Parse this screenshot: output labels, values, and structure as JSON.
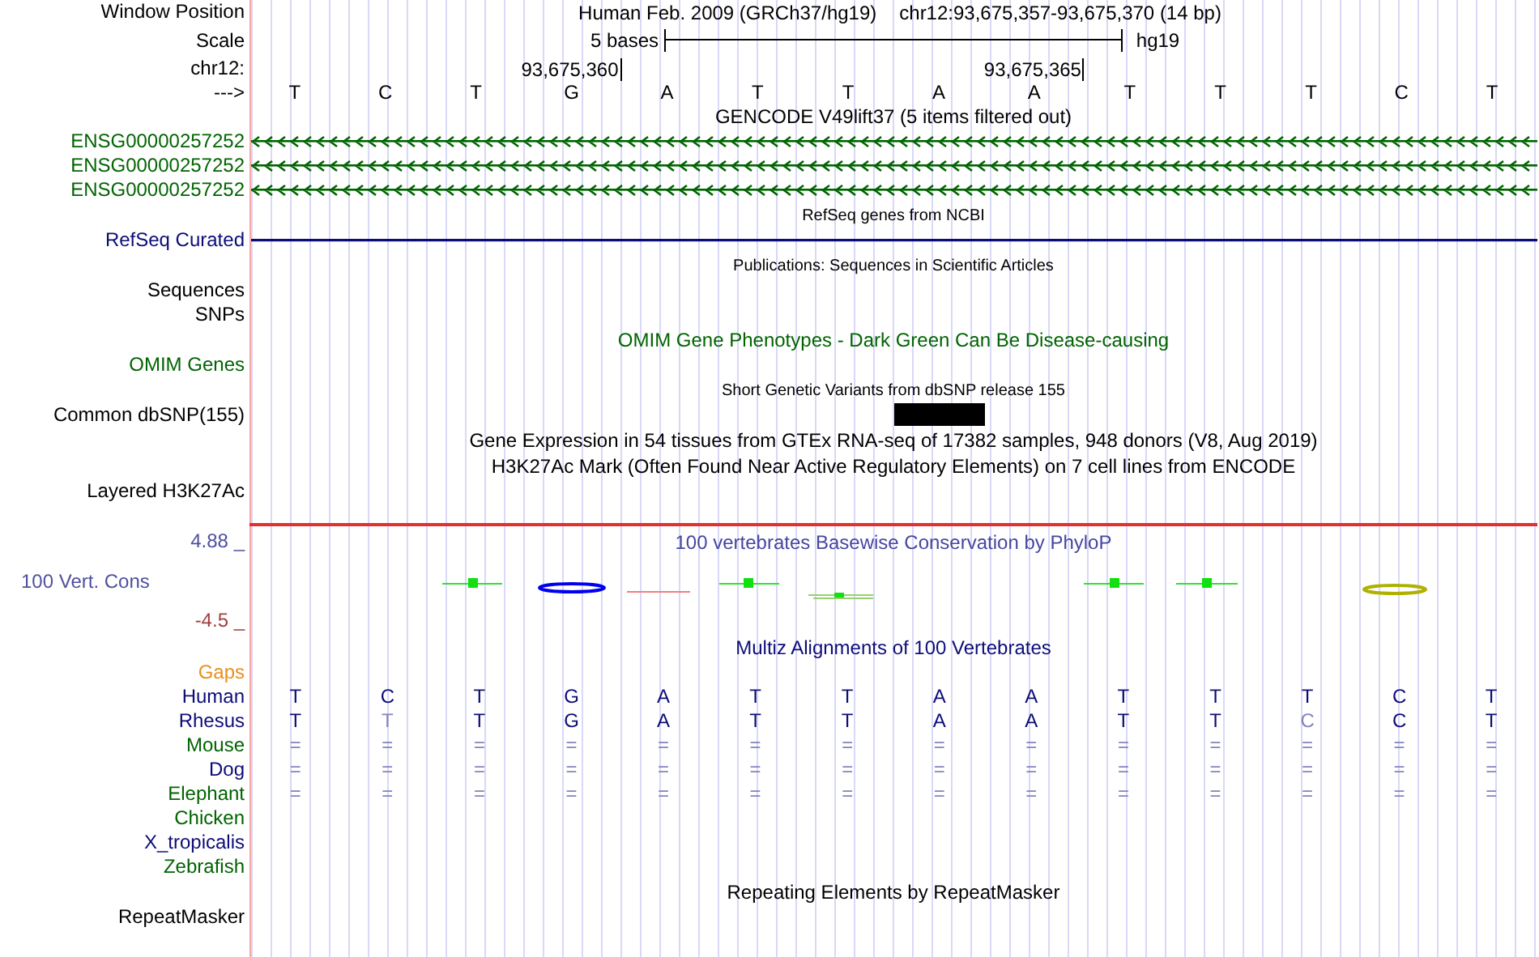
{
  "rows": [
    {
      "kind": "title",
      "label": "Window Position",
      "assembly": "Human Feb. 2009 (GRCh37/hg19)",
      "position": "chr12:93,675,357-93,675,370 (14 bp)"
    },
    {
      "kind": "scale",
      "label": "Scale",
      "span": "5 bases",
      "assembly": "hg19"
    },
    {
      "kind": "sequence",
      "coordinate_label": "chr12:",
      "label": "--->",
      "bases": [
        {
          "base": "T",
          "variant": false
        },
        {
          "base": "C",
          "variant": false
        },
        {
          "base": "T",
          "variant": false
        },
        {
          "base": "G",
          "coordinate": "93,675,360",
          "variant": false
        },
        {
          "base": "A",
          "variant": false
        },
        {
          "base": "T",
          "variant": false
        },
        {
          "base": "T",
          "variant": false
        },
        {
          "base": "A",
          "variant": true
        },
        {
          "base": "A",
          "coordinate": "93,675,365",
          "variant": false
        },
        {
          "base": "T",
          "variant": false
        },
        {
          "base": "T",
          "variant": false
        },
        {
          "base": "T",
          "variant": false
        },
        {
          "base": "C",
          "variant": false
        },
        {
          "base": "T",
          "variant": false
        }
      ]
    },
    {
      "kind": "header",
      "text": "GENCODE V49lift37 (5 items filtered out)"
    },
    {
      "kind": "gene",
      "label": "ENSG00000257252",
      "color": "#006400",
      "arrows": true
    },
    {
      "kind": "gene",
      "label": "ENSG00000257252",
      "color": "#006400",
      "arrows": true
    },
    {
      "kind": "gene",
      "label": "ENSG00000257252",
      "color": "#006400",
      "arrows": true
    },
    {
      "kind": "caption",
      "text": "RefSeq genes from NCBI"
    },
    {
      "kind": "gene",
      "label": "RefSeq Curated",
      "color": "#0c0c78",
      "arrows": false
    },
    {
      "kind": "caption",
      "text": "Publications: Sequences in Scientific Articles"
    },
    {
      "kind": "label",
      "label": "Sequences"
    },
    {
      "kind": "label",
      "label": "SNPs"
    },
    {
      "kind": "header",
      "text": "OMIM Gene Phenotypes - Dark Green Can Be Disease-causing",
      "color": "#006400"
    },
    {
      "kind": "label",
      "label": "OMIM Genes",
      "color": "#006400"
    },
    {
      "kind": "caption",
      "text": "Short Genetic Variants from dbSNP release 155"
    },
    {
      "kind": "variants",
      "label": "Common dbSNP(155)"
    },
    {
      "kind": "header",
      "text": "Gene Expression in 54 tissues from GTEx RNA-seq of 17382 samples, 948 donors (V8, Aug 2019)"
    },
    {
      "kind": "header",
      "text": "H3K27Ac Mark (Often Found Near Active Regulatory Elements) on 7 cell lines from ENCODE"
    },
    {
      "kind": "signal",
      "label": "Layered H3K27Ac"
    },
    {
      "kind": "conservation",
      "max": "4.88 _",
      "title": "100 vertebrates Basewise Conservation by PhyloP",
      "label": "100 Vert. Cons",
      "min": "-4.5 _"
    },
    {
      "kind": "header",
      "text": "Multiz Alignments of 100 Vertebrates",
      "color": "#0c0c78"
    },
    {
      "kind": "label",
      "label": "Gaps",
      "color": "#e8901c"
    },
    {
      "kind": "alignment",
      "label": "Human",
      "color": "#0c0c78",
      "bases": [
        {
          "text": "T",
          "faded": false
        },
        {
          "text": "C",
          "faded": false
        },
        {
          "text": "T",
          "faded": false
        },
        {
          "text": "G",
          "faded": false
        },
        {
          "text": "A",
          "faded": false
        },
        {
          "text": "T",
          "faded": false
        },
        {
          "text": "T",
          "faded": false
        },
        {
          "text": "A",
          "faded": false
        },
        {
          "text": "A",
          "faded": false
        },
        {
          "text": "T",
          "faded": false
        },
        {
          "text": "T",
          "faded": false
        },
        {
          "text": "T",
          "faded": false
        },
        {
          "text": "C",
          "faded": false
        },
        {
          "text": "T",
          "faded": false
        }
      ]
    },
    {
      "kind": "alignment",
      "label": "Rhesus",
      "color": "#0c0c78",
      "bases": [
        {
          "text": "T",
          "faded": false
        },
        {
          "text": "T",
          "faded": true
        },
        {
          "text": "T",
          "faded": false
        },
        {
          "text": "G",
          "faded": false
        },
        {
          "text": "A",
          "faded": false
        },
        {
          "text": "T",
          "faded": false
        },
        {
          "text": "T",
          "faded": false
        },
        {
          "text": "A",
          "faded": false
        },
        {
          "text": "A",
          "faded": false
        },
        {
          "text": "T",
          "faded": false
        },
        {
          "text": "T",
          "faded": false
        },
        {
          "text": "C",
          "faded": true
        },
        {
          "text": "C",
          "faded": false
        },
        {
          "text": "T",
          "faded": false
        }
      ]
    },
    {
      "kind": "alignment",
      "label": "Mouse",
      "color": "#006400",
      "bases": [
        {
          "text": "=",
          "faded": true
        },
        {
          "text": "=",
          "faded": true
        },
        {
          "text": "=",
          "faded": true
        },
        {
          "text": "=",
          "faded": true
        },
        {
          "text": "=",
          "faded": true
        },
        {
          "text": "=",
          "faded": true
        },
        {
          "text": "=",
          "faded": true
        },
        {
          "text": "=",
          "faded": true
        },
        {
          "text": "=",
          "faded": true
        },
        {
          "text": "=",
          "faded": true
        },
        {
          "text": "=",
          "faded": true
        },
        {
          "text": "=",
          "faded": true
        },
        {
          "text": "=",
          "faded": true
        },
        {
          "text": "=",
          "faded": true
        }
      ]
    },
    {
      "kind": "alignment",
      "label": "Dog",
      "color": "#0c0c78",
      "bases": [
        {
          "text": "=",
          "faded": true
        },
        {
          "text": "=",
          "faded": true
        },
        {
          "text": "=",
          "faded": true
        },
        {
          "text": "=",
          "faded": true
        },
        {
          "text": "=",
          "faded": true
        },
        {
          "text": "=",
          "faded": true
        },
        {
          "text": "=",
          "faded": true
        },
        {
          "text": "=",
          "faded": true
        },
        {
          "text": "=",
          "faded": true
        },
        {
          "text": "=",
          "faded": true
        },
        {
          "text": "=",
          "faded": true
        },
        {
          "text": "=",
          "faded": true
        },
        {
          "text": "=",
          "faded": true
        },
        {
          "text": "=",
          "faded": true
        }
      ]
    },
    {
      "kind": "alignment",
      "label": "Elephant",
      "color": "#006400",
      "bases": [
        {
          "text": "=",
          "faded": true
        },
        {
          "text": "=",
          "faded": true
        },
        {
          "text": "=",
          "faded": true
        },
        {
          "text": "=",
          "faded": true
        },
        {
          "text": "=",
          "faded": true
        },
        {
          "text": "=",
          "faded": true
        },
        {
          "text": "=",
          "faded": true
        },
        {
          "text": "=",
          "faded": true
        },
        {
          "text": "=",
          "faded": true
        },
        {
          "text": "=",
          "faded": true
        },
        {
          "text": "=",
          "faded": true
        },
        {
          "text": "=",
          "faded": true
        },
        {
          "text": "=",
          "faded": true
        },
        {
          "text": "=",
          "faded": true
        }
      ]
    },
    {
      "kind": "alignment",
      "label": "Chicken",
      "color": "#006400"
    },
    {
      "kind": "alignment",
      "label": "X_tropicalis",
      "color": "#0c0c78"
    },
    {
      "kind": "alignment",
      "label": "Zebrafish",
      "color": "#006400"
    },
    {
      "kind": "header",
      "text": "Repeating Elements by RepeatMasker"
    },
    {
      "kind": "label",
      "label": "RepeatMasker"
    }
  ]
}
